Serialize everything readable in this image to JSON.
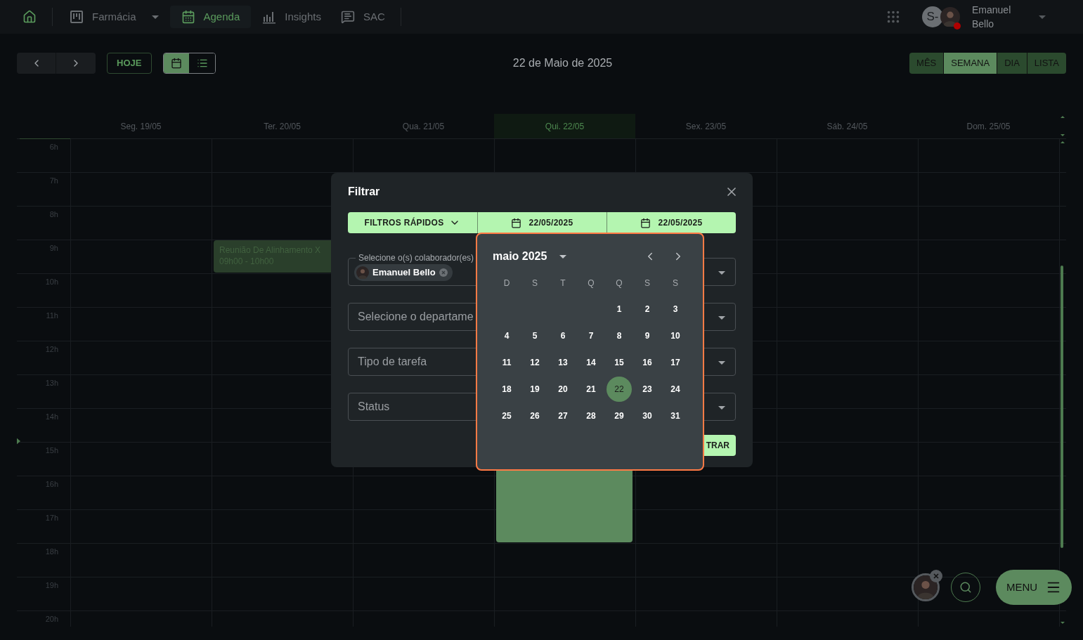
{
  "nav": {
    "items": [
      {
        "kind": "home",
        "selected": false
      },
      {
        "kind": "board",
        "label": "Farmácia",
        "selected": false
      },
      {
        "kind": "calendar",
        "label": "Agenda",
        "selected": true
      },
      {
        "kind": "chart",
        "label": "Insights",
        "selected": false
      },
      {
        "kind": "chat",
        "label": "SAC",
        "selected": false
      }
    ],
    "user": {
      "initials": "S-",
      "name": "Emanuel Bello"
    }
  },
  "toolbar": {
    "today": "HOJE",
    "display": [
      {
        "kind": "calendar",
        "selected": true
      },
      {
        "kind": "list",
        "selected": false
      }
    ],
    "title": "22 de Maio de 2025",
    "views": [
      {
        "label": "MÊS",
        "selected": false
      },
      {
        "label": "SEMANA",
        "selected": true
      },
      {
        "label": "DIA",
        "selected": false
      },
      {
        "label": "LISTA",
        "selected": false
      }
    ]
  },
  "calendar": {
    "days": [
      {
        "label": "Seg. 19/05",
        "selected": false
      },
      {
        "label": "Ter. 20/05",
        "selected": false,
        "events": [
          {
            "kind": "labeled",
            "title": "Reunião De Alinhamento X",
            "time": "09h00 - 10h00"
          }
        ]
      },
      {
        "label": "Qua. 21/05",
        "selected": false
      },
      {
        "label": "Qui. 22/05",
        "selected": true,
        "events": [
          {
            "kind": "plain"
          }
        ]
      },
      {
        "label": "Sex. 23/05",
        "selected": false
      },
      {
        "label": "Sáb. 24/05",
        "selected": false
      },
      {
        "label": "Dom. 25/05",
        "selected": false
      }
    ],
    "hours": [
      "6h",
      "7h",
      "8h",
      "9h",
      "10h",
      "11h",
      "12h",
      "13h",
      "14h",
      "15h",
      "16h",
      "17h",
      "18h",
      "19h",
      "20h"
    ]
  },
  "filter": {
    "title": "Filtrar",
    "quick_filters": "FILTROS RÁPIDOS",
    "dates": [
      "22/05/2025",
      "22/05/2025"
    ],
    "fields": [
      {
        "kind": "chips",
        "label": "Selecione o(s) colaborador(es)",
        "chips": [
          "Emanuel Bello"
        ]
      },
      {
        "kind": "select",
        "placeholder": "Selecione o departame"
      },
      {
        "kind": "select",
        "placeholder": "Tipo de tarefa"
      },
      {
        "kind": "select",
        "placeholder": "Status"
      }
    ],
    "submit": "TRAR"
  },
  "datepicker": {
    "month": "maio 2025",
    "weekdays": [
      "D",
      "S",
      "T",
      "Q",
      "Q",
      "S",
      "S"
    ],
    "weeks": [
      {
        "days": [
          {
            "label": "1",
            "selected": false
          },
          {
            "label": "2",
            "selected": false
          },
          {
            "label": "3",
            "selected": false
          }
        ]
      },
      {
        "days": [
          {
            "label": "4",
            "selected": false
          },
          {
            "label": "5",
            "selected": false
          },
          {
            "label": "6",
            "selected": false
          },
          {
            "label": "7",
            "selected": false
          },
          {
            "label": "8",
            "selected": false
          },
          {
            "label": "9",
            "selected": false
          },
          {
            "label": "10",
            "selected": false
          }
        ]
      },
      {
        "days": [
          {
            "label": "11",
            "selected": false
          },
          {
            "label": "12",
            "selected": false
          },
          {
            "label": "13",
            "selected": false
          },
          {
            "label": "14",
            "selected": false
          },
          {
            "label": "15",
            "selected": false
          },
          {
            "label": "16",
            "selected": false
          },
          {
            "label": "17",
            "selected": false
          }
        ]
      },
      {
        "days": [
          {
            "label": "18",
            "selected": false
          },
          {
            "label": "19",
            "selected": false
          },
          {
            "label": "20",
            "selected": false
          },
          {
            "label": "21",
            "selected": false
          },
          {
            "label": "22",
            "selected": true
          },
          {
            "label": "23",
            "selected": false
          },
          {
            "label": "24",
            "selected": false
          }
        ]
      },
      {
        "days": [
          {
            "label": "25",
            "selected": false
          },
          {
            "label": "26",
            "selected": false
          },
          {
            "label": "27",
            "selected": false
          },
          {
            "label": "28",
            "selected": false
          },
          {
            "label": "29",
            "selected": false
          },
          {
            "label": "30",
            "selected": false
          },
          {
            "label": "31",
            "selected": false
          }
        ]
      }
    ]
  },
  "fab": {
    "menu": "MENU"
  }
}
